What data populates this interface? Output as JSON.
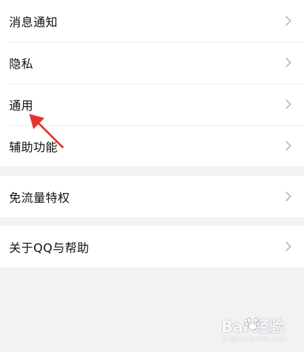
{
  "settings": {
    "group1": [
      {
        "label": "消息通知"
      },
      {
        "label": "隐私"
      },
      {
        "label": "通用"
      },
      {
        "label": "辅助功能"
      }
    ],
    "group2": [
      {
        "label": "免流量特权"
      }
    ],
    "group3": [
      {
        "label": "关于QQ与帮助"
      }
    ]
  },
  "watermark": {
    "main": "Bai 经验",
    "sub": "jingyan.baidu.com"
  },
  "colors": {
    "background": "#f2f2f5",
    "row_background": "#ffffff",
    "text": "#111111",
    "chevron": "#b5b5b8",
    "annotation_arrow": "#e8322e"
  },
  "icons": {
    "chevron": "chevron-right-icon",
    "arrow": "red-arrow-annotation"
  }
}
